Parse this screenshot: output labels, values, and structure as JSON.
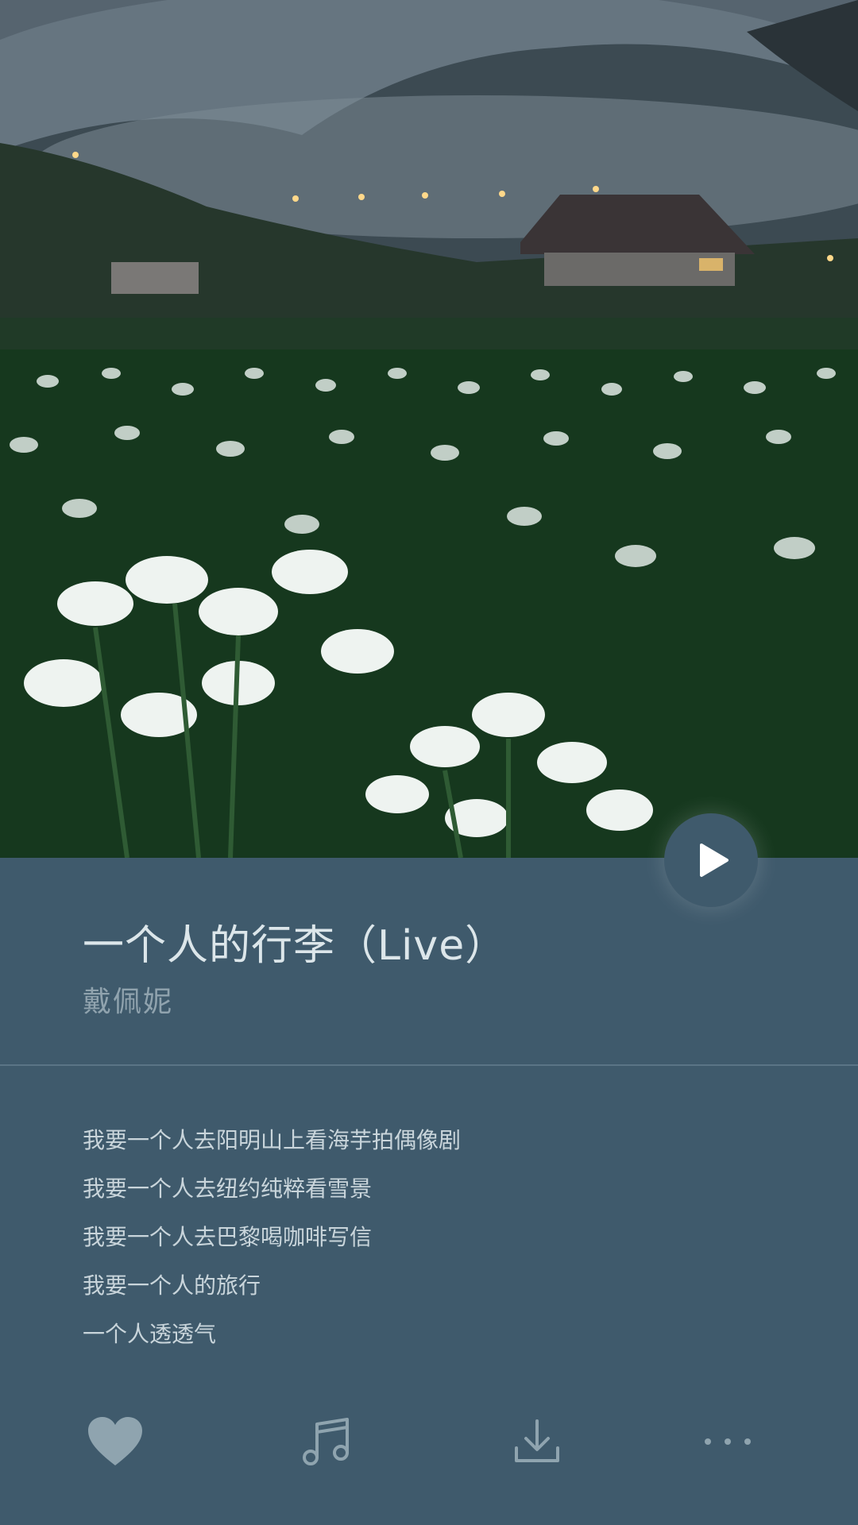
{
  "cover": {
    "image": "calla-lily-field-misty-mountains-photo"
  },
  "player": {
    "play_icon": "play-icon"
  },
  "song": {
    "title": "一个人的行李（Live）",
    "artist": "戴佩妮"
  },
  "lyrics": [
    "我要一个人去阳明山上看海芋拍偶像剧",
    "我要一个人去纽约纯粹看雪景",
    "我要一个人去巴黎喝咖啡写信",
    "我要一个人的旅行",
    "一个人透透气"
  ],
  "toolbar": {
    "items": [
      "heart-icon",
      "music-note-icon",
      "download-icon",
      "more-icon"
    ]
  },
  "colors": {
    "background": "#3f5a6c",
    "title": "#dce6ea",
    "artist": "#90a3ae",
    "lyric": "#c9d5db",
    "icon": "#8fa4af"
  }
}
